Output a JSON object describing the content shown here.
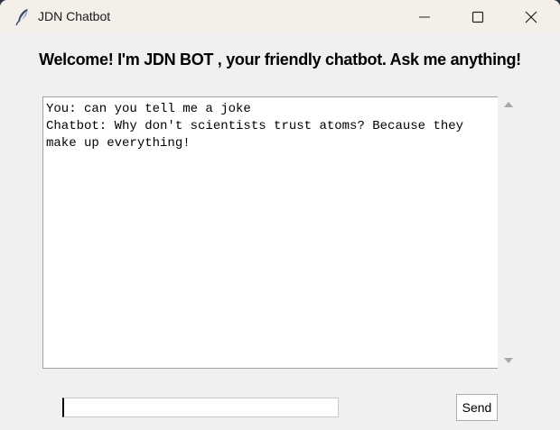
{
  "window": {
    "title": "JDN Chatbot",
    "controls": {
      "minimize": "minimize-icon",
      "maximize": "maximize-icon",
      "close": "close-icon"
    }
  },
  "header": {
    "welcome": "Welcome! I'm JDN BOT , your friendly chatbot. Ask me anything!"
  },
  "chat": {
    "messages": [
      "You: can you tell me a joke",
      "Chatbot: Why don't scientists trust atoms? Because they make up everything!"
    ]
  },
  "input": {
    "value": "",
    "placeholder": ""
  },
  "send": {
    "label": "Send"
  }
}
